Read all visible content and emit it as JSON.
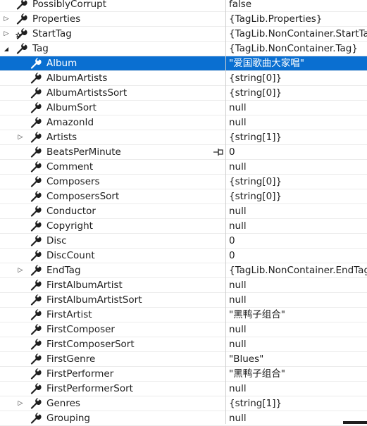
{
  "rows": [
    {
      "name": "PossiblyCorrupt",
      "value": "false",
      "level": 1,
      "expander": "none",
      "icon": "wrench-icon"
    },
    {
      "name": "Properties",
      "value": "{TagLib.Properties}",
      "level": 1,
      "expander": "collapsed",
      "icon": "wrench-icon"
    },
    {
      "name": "StartTag",
      "value": "{TagLib.NonContainer.StartTag}",
      "level": 1,
      "expander": "collapsed",
      "icon": "wrench-star-icon"
    },
    {
      "name": "Tag",
      "value": "{TagLib.NonContainer.Tag}",
      "level": 1,
      "expander": "expanded",
      "icon": "wrench-icon"
    },
    {
      "name": "Album",
      "value": "\"爱国歌曲大家唱\"",
      "level": 2,
      "expander": "none",
      "icon": "wrench-icon",
      "selected": true
    },
    {
      "name": "AlbumArtists",
      "value": "{string[0]}",
      "level": 2,
      "expander": "none",
      "icon": "wrench-icon"
    },
    {
      "name": "AlbumArtistsSort",
      "value": "{string[0]}",
      "level": 2,
      "expander": "none",
      "icon": "wrench-icon"
    },
    {
      "name": "AlbumSort",
      "value": "null",
      "level": 2,
      "expander": "none",
      "icon": "wrench-icon"
    },
    {
      "name": "AmazonId",
      "value": "null",
      "level": 2,
      "expander": "none",
      "icon": "wrench-icon"
    },
    {
      "name": "Artists",
      "value": "{string[1]}",
      "level": 2,
      "expander": "collapsed",
      "icon": "wrench-icon"
    },
    {
      "name": "BeatsPerMinute",
      "value": "0",
      "level": 2,
      "expander": "none",
      "icon": "wrench-icon",
      "pin": true
    },
    {
      "name": "Comment",
      "value": "null",
      "level": 2,
      "expander": "none",
      "icon": "wrench-icon"
    },
    {
      "name": "Composers",
      "value": "{string[0]}",
      "level": 2,
      "expander": "none",
      "icon": "wrench-icon"
    },
    {
      "name": "ComposersSort",
      "value": "{string[0]}",
      "level": 2,
      "expander": "none",
      "icon": "wrench-icon"
    },
    {
      "name": "Conductor",
      "value": "null",
      "level": 2,
      "expander": "none",
      "icon": "wrench-icon"
    },
    {
      "name": "Copyright",
      "value": "null",
      "level": 2,
      "expander": "none",
      "icon": "wrench-icon"
    },
    {
      "name": "Disc",
      "value": "0",
      "level": 2,
      "expander": "none",
      "icon": "wrench-icon"
    },
    {
      "name": "DiscCount",
      "value": "0",
      "level": 2,
      "expander": "none",
      "icon": "wrench-icon"
    },
    {
      "name": "EndTag",
      "value": "{TagLib.NonContainer.EndTag}",
      "level": 2,
      "expander": "collapsed",
      "icon": "wrench-icon"
    },
    {
      "name": "FirstAlbumArtist",
      "value": "null",
      "level": 2,
      "expander": "none",
      "icon": "wrench-icon"
    },
    {
      "name": "FirstAlbumArtistSort",
      "value": "null",
      "level": 2,
      "expander": "none",
      "icon": "wrench-icon"
    },
    {
      "name": "FirstArtist",
      "value": "\"黑鸭子组合\"",
      "level": 2,
      "expander": "none",
      "icon": "wrench-icon"
    },
    {
      "name": "FirstComposer",
      "value": "null",
      "level": 2,
      "expander": "none",
      "icon": "wrench-icon"
    },
    {
      "name": "FirstComposerSort",
      "value": "null",
      "level": 2,
      "expander": "none",
      "icon": "wrench-icon"
    },
    {
      "name": "FirstGenre",
      "value": "\"Blues\"",
      "level": 2,
      "expander": "none",
      "icon": "wrench-icon"
    },
    {
      "name": "FirstPerformer",
      "value": "\"黑鸭子组合\"",
      "level": 2,
      "expander": "none",
      "icon": "wrench-icon"
    },
    {
      "name": "FirstPerformerSort",
      "value": "null",
      "level": 2,
      "expander": "none",
      "icon": "wrench-icon"
    },
    {
      "name": "Genres",
      "value": "{string[1]}",
      "level": 2,
      "expander": "collapsed",
      "icon": "wrench-icon"
    },
    {
      "name": "Grouping",
      "value": "null",
      "level": 2,
      "expander": "none",
      "icon": "wrench-icon"
    }
  ],
  "colors": {
    "selection": "#0a6fd1",
    "text": "#1e1e1e",
    "icon": "#1e1e1e"
  }
}
